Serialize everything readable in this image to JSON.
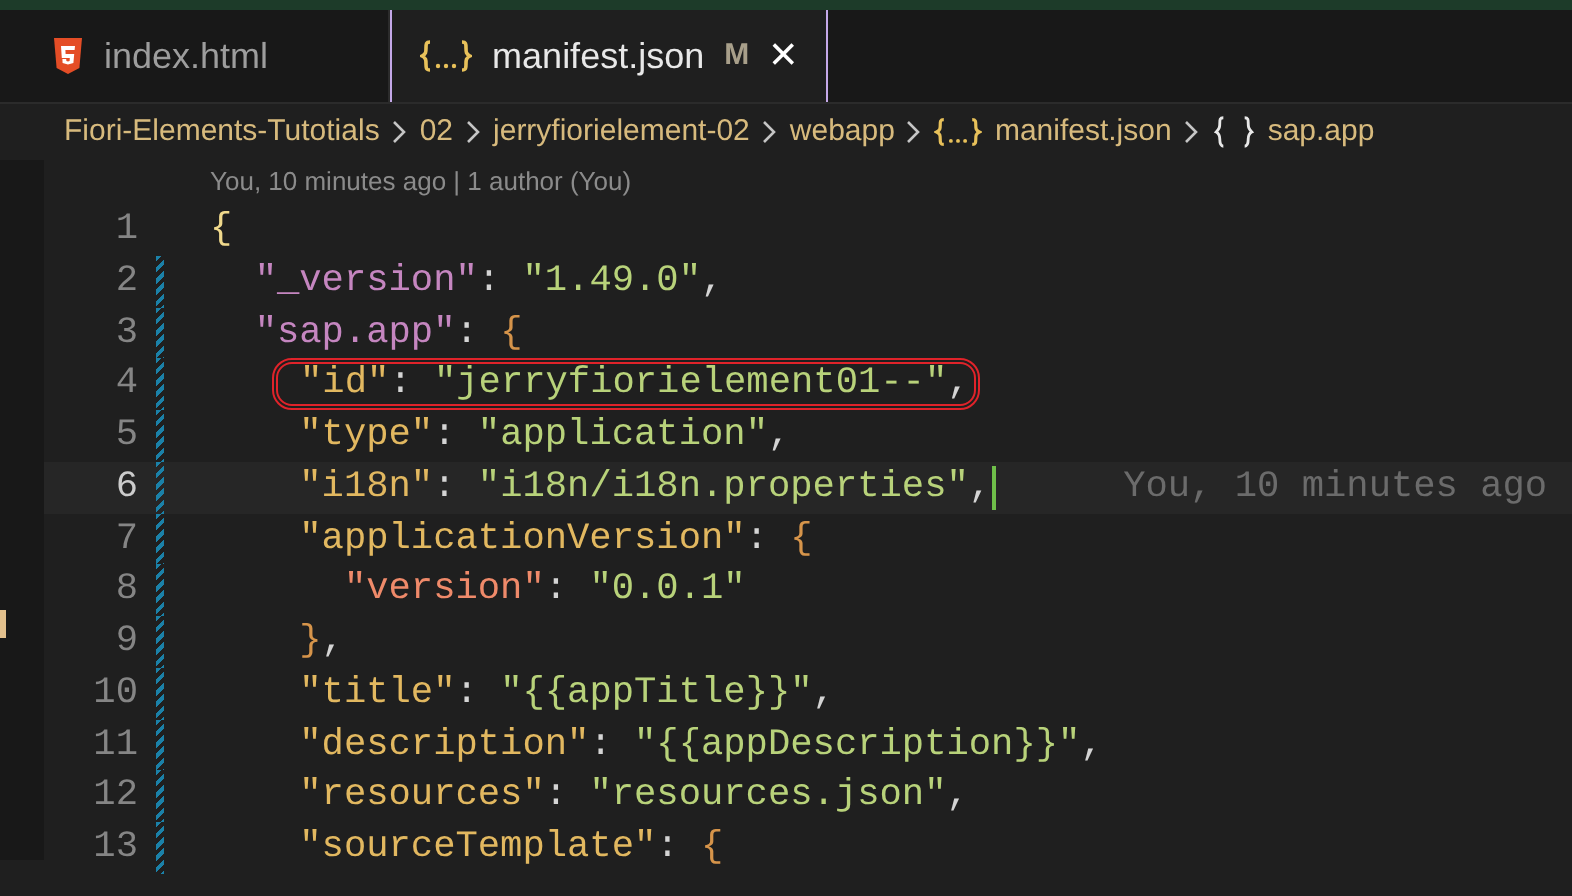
{
  "tabs": [
    {
      "label": "index.html",
      "kind": "html",
      "selected": false,
      "modified": false
    },
    {
      "label": "manifest.json",
      "kind": "json",
      "selected": true,
      "modified": true,
      "badge": "M",
      "close": "×"
    }
  ],
  "breadcrumbs": [
    {
      "label": "Fiori-Elements-Tutotials",
      "kind": "folder"
    },
    {
      "label": "02",
      "kind": "folder"
    },
    {
      "label": "jerryfiorielement-02",
      "kind": "folder"
    },
    {
      "label": "webapp",
      "kind": "folder"
    },
    {
      "label": "manifest.json",
      "kind": "json"
    },
    {
      "label": "sap.app",
      "kind": "object"
    }
  ],
  "blame_header": "You, 10 minutes ago | 1 author (You)",
  "lines": [
    {
      "number": "1",
      "modified": false,
      "current": false,
      "highlighted": false,
      "tokens": [
        {
          "kind": "brace",
          "text": "{"
        }
      ]
    },
    {
      "number": "2",
      "modified": true,
      "current": false,
      "highlighted": false,
      "tokens": [
        {
          "kind": "root-key",
          "text": "  \"_version\""
        },
        {
          "kind": "punct",
          "text": ": "
        },
        {
          "kind": "string",
          "text": "\"1.49.0\""
        },
        {
          "kind": "punct",
          "text": ","
        }
      ]
    },
    {
      "number": "3",
      "modified": true,
      "current": false,
      "highlighted": false,
      "tokens": [
        {
          "kind": "root-key",
          "text": "  \"sap.app\""
        },
        {
          "kind": "punct",
          "text": ": "
        },
        {
          "kind": "inner-brace",
          "text": "{"
        }
      ]
    },
    {
      "number": "4",
      "modified": true,
      "current": false,
      "highlighted": true,
      "tokens": [
        {
          "kind": "key",
          "text": "    \"id\""
        },
        {
          "kind": "punct",
          "text": ": "
        },
        {
          "kind": "string",
          "text": "\"jerryfiorielement01--\""
        },
        {
          "kind": "punct",
          "text": ","
        }
      ]
    },
    {
      "number": "5",
      "modified": true,
      "current": false,
      "highlighted": false,
      "tokens": [
        {
          "kind": "key",
          "text": "    \"type\""
        },
        {
          "kind": "punct",
          "text": ": "
        },
        {
          "kind": "string",
          "text": "\"application\""
        },
        {
          "kind": "punct",
          "text": ","
        }
      ]
    },
    {
      "number": "6",
      "modified": true,
      "current": true,
      "highlighted": false,
      "blame": "You, 10 minutes ago",
      "tokens": [
        {
          "kind": "key",
          "text": "    \"i18n\""
        },
        {
          "kind": "punct",
          "text": ": "
        },
        {
          "kind": "string",
          "text": "\"i18n/i18n.properties\""
        },
        {
          "kind": "punct",
          "text": ","
        }
      ]
    },
    {
      "number": "7",
      "modified": true,
      "current": false,
      "highlighted": false,
      "tokens": [
        {
          "kind": "key",
          "text": "    \"applicationVersion\""
        },
        {
          "kind": "punct",
          "text": ": "
        },
        {
          "kind": "inner-brace",
          "text": "{"
        }
      ]
    },
    {
      "number": "8",
      "modified": true,
      "current": false,
      "highlighted": false,
      "tokens": [
        {
          "kind": "sub-key",
          "text": "      \"version\""
        },
        {
          "kind": "punct",
          "text": ": "
        },
        {
          "kind": "string",
          "text": "\"0.0.1\""
        }
      ]
    },
    {
      "number": "9",
      "modified": true,
      "current": false,
      "highlighted": false,
      "tokens": [
        {
          "kind": "inner-brace",
          "text": "    }"
        },
        {
          "kind": "punct",
          "text": ","
        }
      ]
    },
    {
      "number": "10",
      "modified": true,
      "current": false,
      "highlighted": false,
      "tokens": [
        {
          "kind": "key",
          "text": "    \"title\""
        },
        {
          "kind": "punct",
          "text": ": "
        },
        {
          "kind": "string",
          "text": "\"{{appTitle}}\""
        },
        {
          "kind": "punct",
          "text": ","
        }
      ]
    },
    {
      "number": "11",
      "modified": true,
      "current": false,
      "highlighted": false,
      "tokens": [
        {
          "kind": "key",
          "text": "    \"description\""
        },
        {
          "kind": "punct",
          "text": ": "
        },
        {
          "kind": "string",
          "text": "\"{{appDescription}}\""
        },
        {
          "kind": "punct",
          "text": ","
        }
      ]
    },
    {
      "number": "12",
      "modified": true,
      "current": false,
      "highlighted": false,
      "tokens": [
        {
          "kind": "key",
          "text": "    \"resources\""
        },
        {
          "kind": "punct",
          "text": ": "
        },
        {
          "kind": "string",
          "text": "\"resources.json\""
        },
        {
          "kind": "punct",
          "text": ","
        }
      ]
    },
    {
      "number": "13",
      "modified": true,
      "current": false,
      "highlighted": false,
      "tokens": [
        {
          "kind": "key",
          "text": "    \"sourceTemplate\""
        },
        {
          "kind": "punct",
          "text": ": "
        },
        {
          "kind": "inner-brace",
          "text": "{"
        }
      ]
    }
  ]
}
